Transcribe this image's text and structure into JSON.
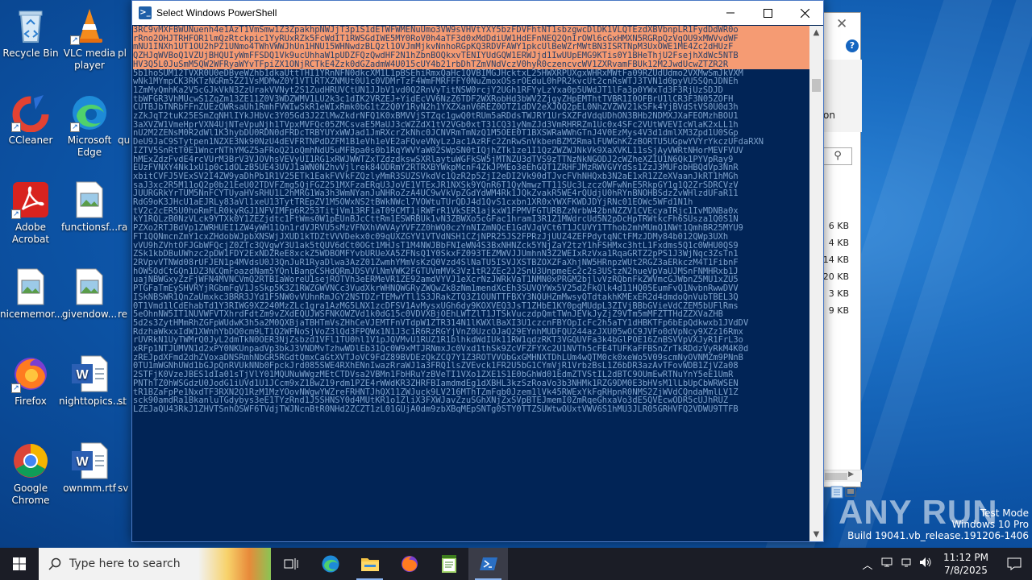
{
  "desktop": {
    "icons": [
      {
        "label": "Recycle Bin"
      },
      {
        "label": "VLC media player"
      },
      {
        "label": "pl"
      },
      {
        "label": "CCleaner"
      },
      {
        "label": "Microsoft Edge"
      },
      {
        "label": "qu"
      },
      {
        "label": "Adobe Acrobat"
      },
      {
        "label": "functionsf..."
      },
      {
        "label": "ra"
      },
      {
        "label": "nicememor..."
      },
      {
        "label": "givendow..."
      },
      {
        "label": "re"
      },
      {
        "label": "Firefox"
      },
      {
        "label": "nighttopics...."
      },
      {
        "label": "st"
      },
      {
        "label": "Google Chrome"
      },
      {
        "label": "ownmm.rtf"
      },
      {
        "label": "sv"
      }
    ]
  },
  "explorer": {
    "partial_text": "on",
    "sizes": [
      "6 KB",
      "4 KB",
      "14 KB",
      "20 KB",
      "3 KB",
      "9 KB"
    ]
  },
  "powershell": {
    "title": "Select Windows PowerShell",
    "selected_lines": [
      "3RC9vMXFBWUNuenh4e1AzT1VmSmw1Z3ZpakhpNWJjT3p1S1dETWFWMENuUmo3VW9sVHVtYXY5bzFDVFhtNT1sbzgwcDlDK1VLQTEzdXBVbnpLR1FydDdWR0o",
      "rRno2OHJTRHFOR1lmQzRtckpic1YyRUxRZk5FcWdIT1RWSGdIWE5MY0RoV0h4aTF3d0xMdDdiUW1HdEFnNEQ2QnIrOWl6cGxHMXN5RGRpQzVqOU9xMWVvdWF",
      "mNU1INXh1UT1OU2hPZ1UNmo4TWhVWWJhUn1HNU15WHNwdzBLQzl1OVJmMjkvNnhoRGpKQ3RDVFAWY1pkcUlBeWZrMWtBN3ISRTNpM3UxOWE1ME4Zc2dHUzF",
      "QZHJqWVBoQ1VZUjBHQUIyWmFFSDQ1Vk9ucUhhaW1pUDZFQzQwdHF2N1hZbnBOQkxvTENIYUdGQW1ERWJjd1IwUUpEMG9KTis0Y1BHeThjU2FsejhXdWc5NTB",
      "HV3Q5L0JuSmM5QW2WFRyaWYvTFpiZX1ONjRCTkE4Zzk0dGZadmW4U015cUY4b21rbDhTZmVNdVczV0hyR0czencvcWV1ZXRvamFBUk12M2JwdUcwZTZR2R"
    ],
    "lines": [
      "5b1hoSUM12TVXR0U0eDByeWZhb1dkaUttTHI1YRnNFN0dkcXM1L1pBSEhiRmxQaHc1QVBIMGJHcktxL25HWXRPUXgxWHRxMWtFa09RZUdUdmo2VXMwSmJkVXM",
      "wNk1MYmpCK3RKTzNGRm5ZZ1VsMDMwZ0Y1VTlRTXZNMUt0U1c0VDMrTzF4WmFMRFFFY0NuZmoxOSsrOEduL0hPR2kvcUt2cnRsWTJ3TVN1d0pyVU5SQnJDNEh",
      "1ZmMyQmhKa2V5cGJkVkN3ZzUrakVVNyt2S1ZudHRUVCtUN1JJbV1vd0Q2RnVyTitNSW0rcjY2UGh1RFYyLzYxa0p5UWdJT1lFa3p0YWxTd3F3RjUzSDJD",
      "tbWFGR3VhMUcwS1ZqZm13ZE11Z0V3WDZWMV1LU2k3c1dIK2VRZEJ+YidEcVV6NzZ6TDF2WXRobHd3bWV2ZjgyZHpEMThtTVBR1I0OFBrU1lCR3F3N05ZOFH",
      "CUTBJbTNRbFFnZUEzQWRsaUh1RmhFVWIwSkR1eWIxRmk0bG1tZ2Q0Y1RyN2h1YXZXanV6REZ0OTZ1dDV2eXJOQ2pEL0NhZVZWV21kSFk4YjBVdStVS0U0d3h",
      "zZkJqT2tuK25ESmZqNHlIYkJHbVc3Y05Gd3J2ZlMwZkdrNFQ1K0xBMVVjSTZqc1gwQ0tRUm5aRDdsTWJRY1UrSXZFdVdqUDhON3BHb2NDMXJXaFEOMzhBOU1",
      "3aXVZW1VmeHprVXN4UjNTeVpuNjh1TVpxMVFQc05ZMCsvaE5MaUJ3cWZZdX1tV2VGb0xtT31CQ31yNmZJd3VmRHRRZm1Uc0x4SFc2VUtWVEVIcWlaK2xLL1h",
      "nU2M2ZENsM0R2dWl1K3hybDU0RDN0dFRDcTRBYUYxWWJad1JmRXcrZkNhc0JCNVRmTmNzQ1M5OEE0T1BXSWRaWWhGTnJ4V0EzMys4V3d1dmlXM3Zpd1U0SGp",
      "DeU9JaC9STytpen1NZXE3Nk90NzU4dEVFRTNPdDZFM1B1eVh1eVE2aFQveVNyLzJac1AzRFc2ZnRwSnVkbenBZM2RmalFUWGhKZzBORTU5UGpwYVYrYkczUFdaRXN",
      "IZTV5SnRtT0E1WncrNThYMGZ5aFRoQ21oQmhNdU5uMFBpa0s0b1RqYWVYaW02SWpSN0tIQjhZTk1ze1I1QzZWZWJNkVk9XaXVKL11sSjAyVWRtNHorMEVFVUV",
      "hMExZdzFvdE4rcVUrM3BrV3VJOVhsVEVyUI1RG1xRWJWWTZxTZdzdkswSXRlaytuWGFkSW5jMTNZU3dTVS9zTTNzNkNGODJ2cWZheXZIU1N6Qk1PYVpRay9",
      "EUzFVNXY4Nk1xU1p0c1dOLzB5UE43UVJ1aWN0N2hvVjlrek84ODRmY2RTRXBYWkpMcnF4ZkJPMEo3eEhGQT1ZRHFJMzRWVGVYdSs1ZzJ3MUFobHBQdVp3NnR",
      "xbitCVFJ5VExSV2I4ZW9yaDhPb1R1V25ETk1EakFVVkFZQzlyMmR3SUZSVkdVc1QzR2p5ZjI2eDI2Vk90dTJvcFVhNHQxb3N2aE1xR1ZZeXVaanJkRT1hMGh",
      "saJ3xc2R5M11oQ2p0b21EeU02TDVFZmg5QjFGZ251MXFzaERqU3JoVE1VTExJR1NXSk9YQnR6T1QyNmwzTT11SUc3LzczOWFwNnE5RkpGY1g1Q2ZrSDRCVzV",
      "JUURGRkYrTUM5NnFCYTUyaHVsRHU1L2hMRG1Wa3h3WmNYanJuNHRoZzA4UC9wVkVpZGdYdWM4Rk1JQkZvakR5WE4rQUdjU0hRYnBNOHBSdzZvWHlzdUFaR11",
      "RdG9oK3JHcU1aEJRLy83aVl1xeU13TytTREpZV1M5OWxNS2tBWkNWcl7VOWtuTUrQDJ4d1QvS1cxbn1XR0xYWXFKWDJDYjRNc01EOWc5WFd1N1h",
      "tV2c2cER5U0hoRmFLR0kyRGJ1NFVIMFp6R253TitjVm13RF1aT09CMT1jRWFrR1VkSER1ajkxW1FPMVFGTURBZzNrbW42bnNZZV1CVEcyaTRjc1IvMDNBa0x",
      "kY1RQLzB0NzVLck9YTXk0Y1ZEZjdtc1FtWms0W1pEUnBJcCttRm1ESWRBUk1vN3ZBWXo5cGFac1hramI3R1Z1MWdrcUd5N2pDcHpTRWtkcFh6SUsza1Q0S1N",
      "PZXo2RTJBdVp1ZWRHUEI1ZW4yWH11Qn1rdVJRVU5sMzVFNXhVWVAyYVFZZ0hWQ0czYnNIZmNQcE1GdVJqVCt6T1JCUVY1TThob2mhMUmQ1NWt1QmhBR25MYU9",
      "FT1QQNmcnZmY1cxZHdobWJpbXNSWjJXUD1kTDZtVVVDekx0c09qUXZGYV1VTVdNSH1CZjNPR25JS2FPRzJjUUZ4ZEFPdytqNCtFMzJDMy84b012QWp3UXh",
      "vVU9hZVhtOFJGbWFQcjZ0ZTc3QVgwY3U1ak5tQUV6dCt0OGt1MHJsT1M4NWJBbFNIeWN4S3BxNHNZck5YNjZaY2tzY1hFSHMxc3htL1Fxdms5Q1c0WHU0QS9",
      "ZSk1kbDBuUWhzc2pDW1FDY2ExNDZReE8xckZ5WDBOMFYvbURUeXA5ZFNsQ1Y0SkxFZ093TEZMWVJJUmhnN3Z2WEIxRzVxa1RqaGRTZ2pPS1J3WjNqc3ZsTn1",
      "2RVpvVTNWd08rUFJEN1p4MVdsU0J3QnJuR1RyaDlwa3AzZ01ZwmhYMmVsKzQ0Vzd4SlNaTU5ISVJXSTBZOXZFaXhjNW5HRnpzWUt2RGZ3aERkczM4T1FibnF",
      "hOW5OdCtGQn1DZ3NCQmFoazdNam5YQnlBanpCSHdQRmJDSVVlNmVWK2FGTUVmMVk3Vz1tR2ZEc2J2SnU3UnpmeEc2c2s3UStzN2hueVpVaUJMSnFNMHRxb1J",
      "uajNBWGxyZzFjWFN4MVNCVmQ2RTBIaWoreU1sejROTVh3eERMeVR1ZE92amdVYVJ1eXcrNzJWRkVaT1NMN0xPRGM2bjlvVzRQbnFkZWVmcGJWbnZ5MU1xZU5",
      "PTGFaTmEySHVRYjRGbmFqV1JsSkp5K3Z1RWZGWVNCc3VudXkrWHNQWGRyZWQwZk8zNm1mendXcEh3SUVQYWx5V25d2FkQlk4d11HQ05EumFvQ1NvbnRwwDVV",
      "ISkNBSWR1QnZaUmxkc3BRR3JYd1F5NW0vVUhnRmJGY2NSTDZrTEMwYTl1S3JRakZTQ3Z1OUNTTFBXY3NQUHZmMwsyQTdtakhKMExER2d4dmdoQnVubTBEL3Q",
      "0T1Vmd1lCdEhabTd1Y3RIWG9XZ240MzZLc1gra1AzMG5LNX1zcDFSV1AvMysxUGh6dy9KOXVEQ3JsT1ZHbE1KY0pqMUdpL3ZIVjBBbGVieVdCZEM5bUFlRms",
      "5eOhnNW5IT1NUVWFVTXhrdFdtZm9vZXdEQUJWSFNKOWZVd1k0dG15c0VDVXBjOEhLWTZlT1JTSkVuczdpQmtTWnJEVkJyZjZ9VTm5mMFZTTHdZZXVaZHB",
      "5d2s3ZytHMmRhZGFpWUdwK3h5a2M0QXBjaTBHTmVsZHhCeVJEMTFnVTdpW1ZTR314N1lKWXlBaXI3U1czcnFBYOpIcFc2h5aTY1dHBKTFp6bEpQdkwxb1JVdDV",
      "RdzhaWkxxIdW1XWnhYbDQ0cm9LT1Q2WFNoSjVoZ3lQd3FPQWx1N1J3c1R6RzRGYjVnZ0UzcOJaQ29EYnhMUDFQU244azJXU05wOC9JVFo0dVpNcy9XZz16Rmx",
      "rUVRkN1UyTWMrQ0JyL2dmTkN0OER3NjZsbzd1VFl1TU0hl1V1pJQVMvU1RUZ1R1blhkdWdIUk11RW1qdzRKT3VGQUVFa3k4bGlPOE16ZnBSVVpVXJyR1FrL3o",
      "xRFp1NTJUMVN1d2xPY0NKUnpadVp3bkJ3VNDMvTzhwWDlEb31Qc0W9xMTJRNmxJc0Vxd1thSk9ZcVFZFYXc2U1NVTh5cFE4TUFKaFFBSnZrTkRDdzVyRkM4K0d",
      "zREJpdXFmd2dhZVoxaDNSRmhNbGR5RGdtQmxCaGtXVTJoVC9FdZ89BVDEzQkZCQ7Y1Z3ROTVVObGxGMHNXTDhLUm4wQTM0ck0xeWo5V09scmNyOVNMZm9PNnB",
      "0TU1mWGNhUWd1bGJpQnRVUkNNb0FpckJrd085SWE4RXhENnIwazRraWJ1a3FRQ1lsZVEvck1FR2U5bG1CYmVjR1VrbzBsL1Z6bDR3azAvTFovWDB1ZjVZa08",
      "2STFjK0VzeJBES1dIa01sTjVlY01MQUNuWWgzMEtCTDVsa2VBMn1FbHRuYzBVeTI1VXo1ZXE1S1E0bGhWd01EdmZTVStIL2dBTC9OUmEwRTNuYnY5eE1UmR",
      "PNThTZ0hWSGdzU0JodG1iUVd1U1JCcm9xZ1BwZ19rdm1PZE4rWWdKR3ZHRFBIamdmdEg1dXBHL3kzSzRoaVo3b3NHMk1RZG9DM0E3bHVsM1lLbUpCbWRWSEN",
      "tR1BZaFpPe1NxdTF3RXN2Q1RzM1MzYOovNWgwYWZreFRHNTJhQX11ZWJuck9LV216MThTZmFqb0Jzem1lVk45RWExYkFqRHpnR0NMS2ZjWVdCQndaMmlLV1Z",
      "sck90amdRa1BkanluTGdybys3eE1TYzRnd1J5SHNSY0d4MUtKR1o1ZliX3FXWJavZzuSGhXNjZxSVpBTEJmemI0ZmRqeGhxaVo3dE5QVEcwODR5cUJhRUZ",
      "LZEJaQU43RkJ1ZHVTSnhOSWF6TVdjTWJNcnBtR0NHd2ZCZT1zL01GUjA0dm9zbXBqMEpSNTg0STY0TTZSUWtwOUxtVWV6S1hMU3JLR05GRHVFQ2VDWU9TTFB"
    ]
  },
  "watermark": "ANY RUN",
  "test_mode": {
    "line1": "Test Mode",
    "line2": "Windows 10 Pro",
    "line3": "Build 19041.vb_release.191206-1406"
  },
  "taskbar": {
    "search_placeholder": "Type here to search",
    "time": "11:12 PM",
    "date": "7/8/2025"
  }
}
